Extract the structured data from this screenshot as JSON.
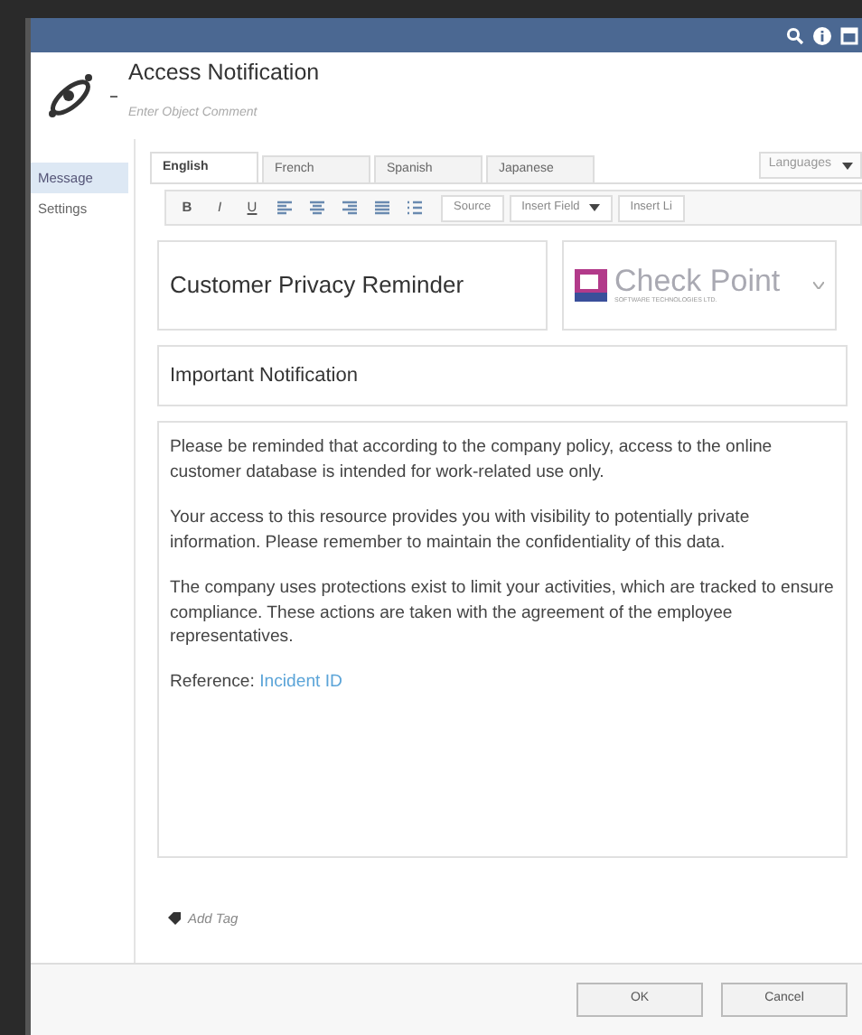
{
  "window": {
    "title": "Access Notification",
    "comment_placeholder": "Enter Object Comment"
  },
  "sidebar": {
    "items": [
      {
        "label": "Message",
        "selected": true
      },
      {
        "label": "Settings",
        "selected": false
      }
    ]
  },
  "tabs": [
    {
      "label": "English",
      "selected": true
    },
    {
      "label": "French",
      "selected": false
    },
    {
      "label": "Spanish",
      "selected": false
    },
    {
      "label": "Japanese",
      "selected": false
    }
  ],
  "languages_button": "Languages",
  "toolbar": {
    "format_buttons": [
      {
        "label": "B",
        "kind": "bold"
      },
      {
        "label": "I",
        "kind": "italic"
      },
      {
        "label": "U",
        "kind": "underline"
      }
    ],
    "source_button": "Source",
    "insert_field_button": "Insert Field",
    "insert_link_button": "Insert Li"
  },
  "subject": "Customer Privacy Reminder",
  "logo": {
    "name": "Check Point",
    "tagline": "SOFTWARE TECHNOLOGIES LTD."
  },
  "heading": "Important Notification",
  "body": {
    "paragraphs": [
      "Please be reminded that according to the company policy, access to the online customer database is intended for work-related use only.",
      "Your access to this resource provides you with visibility to potentially private information. Please remember to maintain the confidentiality of this data.",
      "The company uses protections exist to limit your activities, which are tracked to ensure compliance. These actions are taken with the agreement of the employee representatives."
    ],
    "reference_label": "Reference:",
    "reference_link": "Incident ID"
  },
  "add_tag": "Add Tag",
  "buttons": [
    "OK",
    "Cancel"
  ]
}
